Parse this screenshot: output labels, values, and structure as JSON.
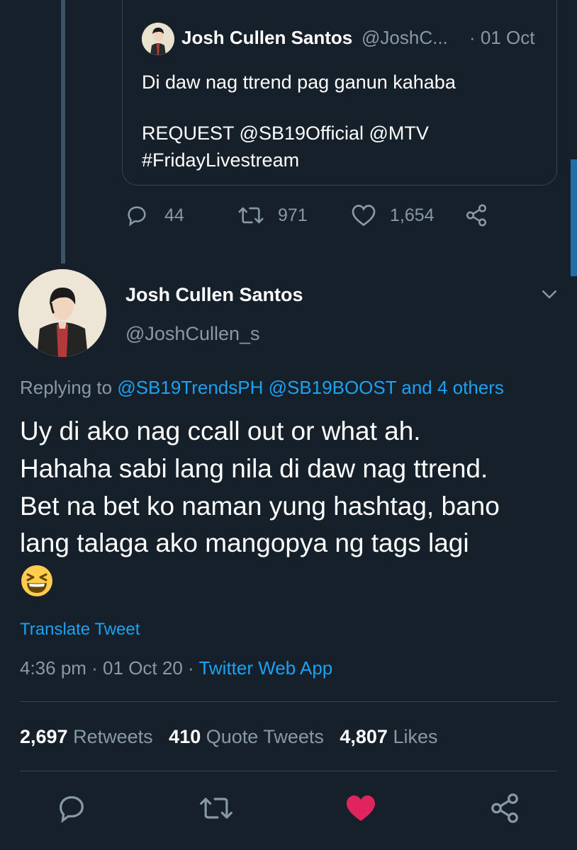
{
  "quoted_tweet": {
    "name": "Josh Cullen Santos",
    "handle": "@JoshC...",
    "date": "· 01 Oct",
    "text_line1": "Di daw nag ttrend pag ganun kahaba",
    "text_line2": "REQUEST @SB19Official @MTV",
    "text_line3": "#FridayLivestream",
    "replies": "44",
    "retweets": "971",
    "likes": "1,654"
  },
  "tweet": {
    "name": "Josh Cullen Santos",
    "handle": "@JoshCullen_s",
    "replying_prefix": "Replying to ",
    "replying_mentions": "@SB19TrendsPH @SB19BOOST and 4 others",
    "body_line1": "Uy di ako nag ccall out or what ah.",
    "body_line2": "Hahaha sabi lang nila di daw nag ttrend.",
    "body_line3": "Bet na bet ko naman yung hashtag, bano",
    "body_line4": "lang talaga ako mangopya ng tags lagi",
    "emoji": "grinning-squinting-face",
    "translate": "Translate Tweet",
    "time": "4:36 pm",
    "date_sep": " · 01 Oct 20 · ",
    "source": "Twitter Web App",
    "retweets_count": "2,697",
    "retweets_label": "Retweets",
    "quote_count": "410",
    "quote_label": "Quote Tweets",
    "likes_count": "4,807",
    "likes_label": "Likes"
  },
  "icons": {
    "reply": "reply-icon",
    "retweet": "retweet-icon",
    "like": "heart-icon",
    "share": "share-icon",
    "menu": "chevron-down-icon"
  },
  "colors": {
    "background": "#15202b",
    "accent": "#1da1f2",
    "muted": "#8899a6",
    "liked": "#e0245e"
  }
}
